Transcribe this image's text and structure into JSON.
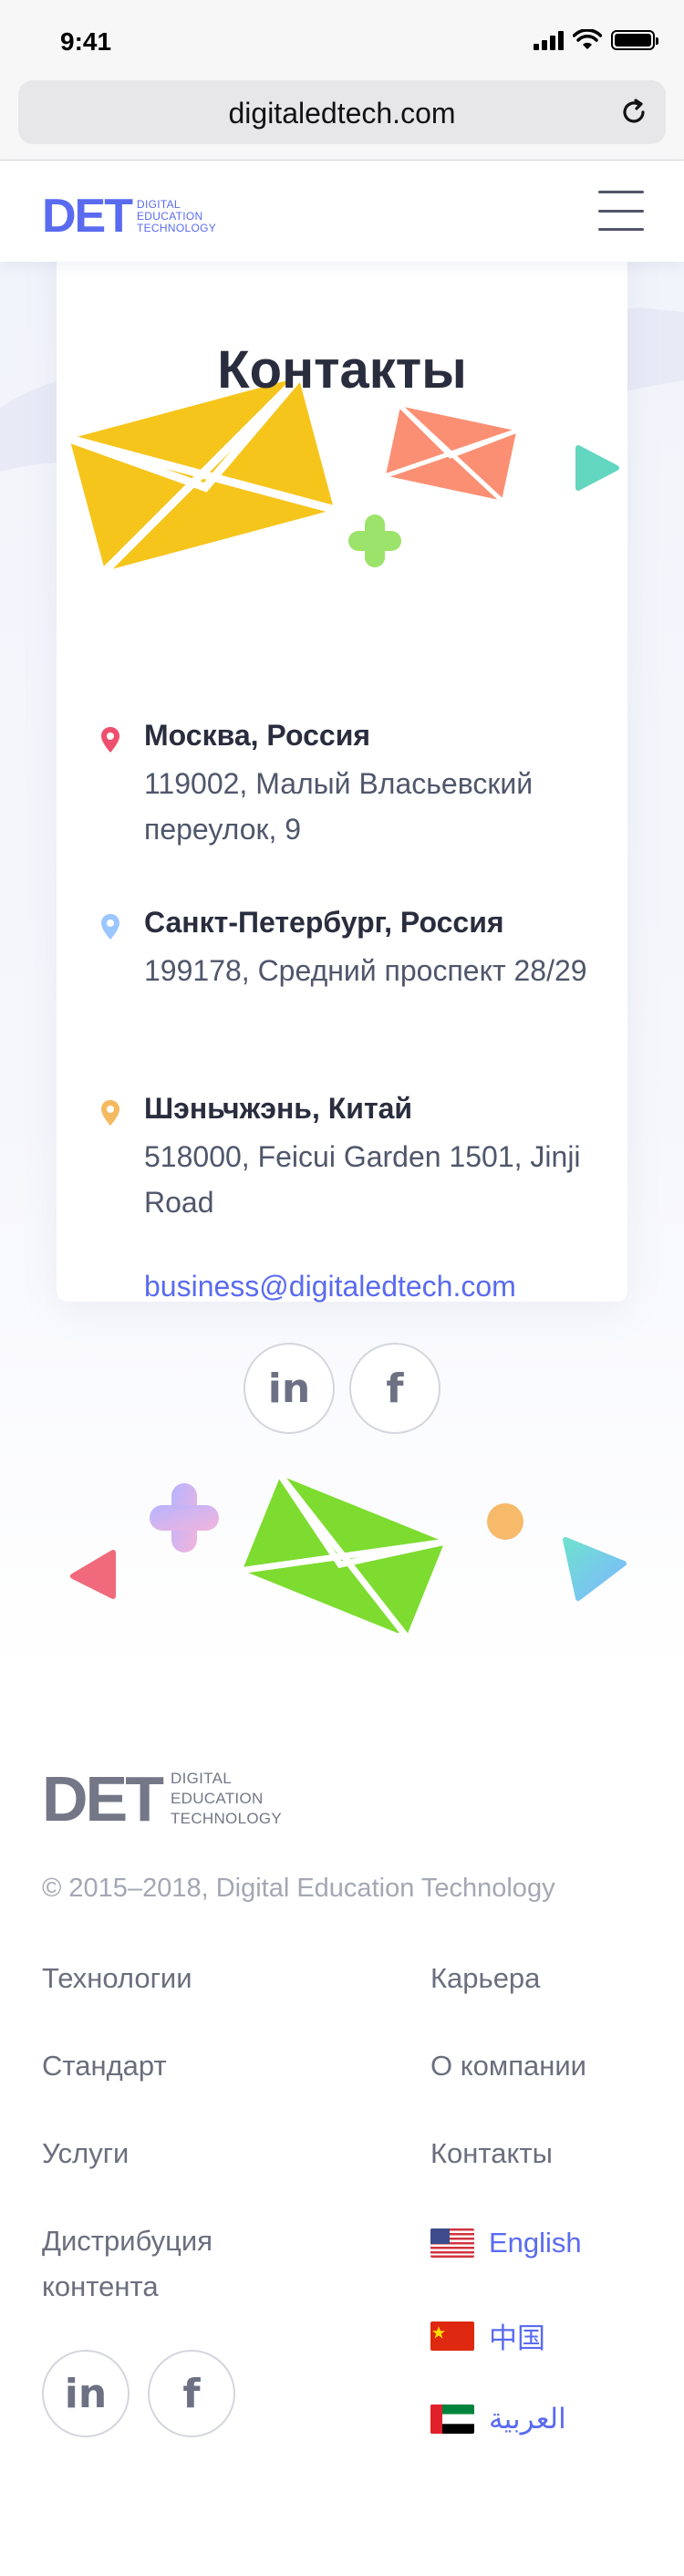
{
  "status_bar": {
    "time": "9:41"
  },
  "browser": {
    "url": "digitaledtech.com"
  },
  "header": {
    "logo_mark": "DET",
    "logo_lines": [
      "DIGITAL",
      "EDUCATION",
      "TECHNOLOGY"
    ],
    "brand_color": "#5a6bf0"
  },
  "contacts": {
    "title": "Контакты",
    "offices": [
      {
        "city": "Москва, Россия",
        "address": "119002, Малый Власьевский переулок, 9",
        "pin_color": "#ef4f6e"
      },
      {
        "city": "Санкт-Петербург, Россия",
        "address": "199178, Средний проспект 28/29",
        "pin_color": "#9bc6ff"
      },
      {
        "city": "Шэньчжэнь, Китай",
        "address": "518000, Feicui Garden 1501, Jinji Road",
        "pin_color": "#f5b95f"
      }
    ],
    "email": "business@digitaledtech.com",
    "social": [
      "linkedin-icon",
      "facebook-icon"
    ]
  },
  "footer": {
    "logo_mark": "DET",
    "logo_lines": [
      "DIGITAL",
      "EDUCATION",
      "TECHNOLOGY"
    ],
    "copyright": "© 2015–2018, Digital Education Technology",
    "left_links": [
      "Технологии",
      "Стандарт",
      "Услуги",
      "Дистрибуция контента"
    ],
    "right_links": [
      "Карьера",
      "О компании",
      "Контакты"
    ],
    "languages": [
      "English",
      "中国",
      "العربية"
    ],
    "link_color": "#6b6e7e",
    "lang_color": "#5a6bf0"
  }
}
